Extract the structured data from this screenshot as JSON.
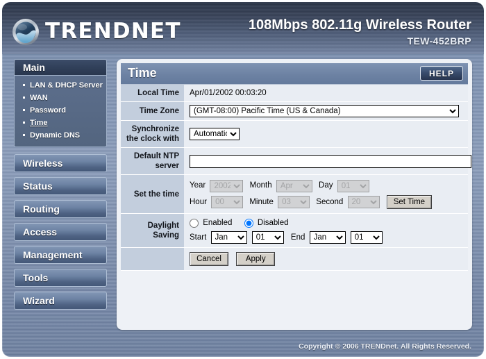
{
  "header": {
    "brand": "TRENDNET",
    "logo_icon": "trendnet-globe-logo-icon",
    "product_title": "108Mbps 802.11g Wireless Router",
    "model": "TEW-452BRP"
  },
  "sidebar": {
    "groups": [
      {
        "label": "Main",
        "type": "expanded",
        "items": [
          {
            "label": "LAN & DHCP Server",
            "active": false
          },
          {
            "label": "WAN",
            "active": false
          },
          {
            "label": "Password",
            "active": false
          },
          {
            "label": "Time",
            "active": true
          },
          {
            "label": "Dynamic DNS",
            "active": false
          }
        ]
      },
      {
        "label": "Wireless",
        "type": "button"
      },
      {
        "label": "Status",
        "type": "button"
      },
      {
        "label": "Routing",
        "type": "button"
      },
      {
        "label": "Access",
        "type": "button"
      },
      {
        "label": "Management",
        "type": "button"
      },
      {
        "label": "Tools",
        "type": "button"
      },
      {
        "label": "Wizard",
        "type": "button"
      }
    ]
  },
  "panel": {
    "title": "Time",
    "help_label": "HELP",
    "rows": {
      "local_time": {
        "label": "Local Time",
        "value": "Apr/01/2002 00:03:20"
      },
      "time_zone": {
        "label": "Time Zone",
        "value": "(GMT-08:00) Pacific Time (US & Canada)",
        "options": [
          "(GMT-08:00) Pacific Time (US & Canada)"
        ]
      },
      "sync_clock": {
        "label": "Synchronize the clock with",
        "value": "Automatic",
        "options": [
          "Automatic"
        ]
      },
      "ntp_server": {
        "label": "Default NTP server",
        "value": "",
        "placeholder": ""
      },
      "set_time": {
        "label": "Set the time",
        "year_label": "Year",
        "year_value": "2002",
        "month_label": "Month",
        "month_value": "Apr",
        "day_label": "Day",
        "day_value": "01",
        "hour_label": "Hour",
        "hour_value": "00",
        "minute_label": "Minute",
        "minute_value": "03",
        "second_label": "Second",
        "second_value": "20",
        "set_time_button": "Set Time",
        "disabled": true
      },
      "daylight_saving": {
        "label": "Daylight Saving",
        "enabled_label": "Enabled",
        "disabled_label": "Disabled",
        "selected": "Disabled",
        "start_label": "Start",
        "start_month": "Jan",
        "start_day": "01",
        "end_label": "End",
        "end_month": "Jan",
        "end_day": "01"
      },
      "actions": {
        "cancel_label": "Cancel",
        "apply_label": "Apply"
      }
    }
  },
  "footer": {
    "copyright": "Copyright © 2006 TRENDnet. All Rights Reserved."
  },
  "colors": {
    "header_dark": "#2c3648",
    "frame_blue": "#8a9cba",
    "panel_title": "#6d82a3",
    "label_cell": "#c3cedd",
    "value_cell": "#e9edf3"
  }
}
